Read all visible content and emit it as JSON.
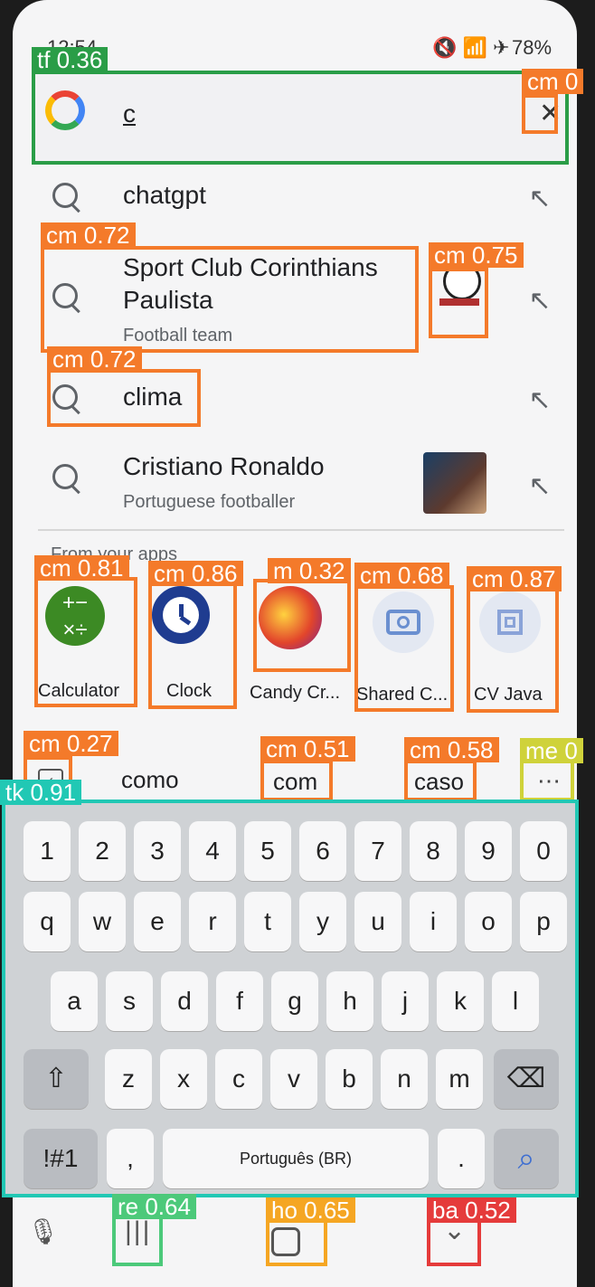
{
  "status": {
    "time": "12:54",
    "battery": "78%"
  },
  "search": {
    "query": "c",
    "clear_icon": "close-icon"
  },
  "suggestions": [
    {
      "title": "chatgpt",
      "subtitle": ""
    },
    {
      "title": "Sport Club Corinthians",
      "title2": "Paulista",
      "subtitle": "Football team"
    },
    {
      "title": "clima",
      "subtitle": ""
    },
    {
      "title": "Cristiano Ronaldo",
      "subtitle": "Portuguese footballer"
    }
  ],
  "apps_section": {
    "label": "From your apps"
  },
  "apps": [
    "Calculator",
    "Clock",
    "Candy Cr...",
    "Shared C...",
    "CV Java"
  ],
  "predictions": [
    "como",
    "com",
    "caso"
  ],
  "keyboard": {
    "row_numbers": [
      "1",
      "2",
      "3",
      "4",
      "5",
      "6",
      "7",
      "8",
      "9",
      "0"
    ],
    "row1": [
      "q",
      "w",
      "e",
      "r",
      "t",
      "y",
      "u",
      "i",
      "o",
      "p"
    ],
    "row2": [
      "a",
      "s",
      "d",
      "f",
      "g",
      "h",
      "j",
      "k",
      "l"
    ],
    "row3": [
      "z",
      "x",
      "c",
      "v",
      "b",
      "n",
      "m"
    ],
    "symbols": "!#1",
    "comma": ",",
    "space_label": "Português (BR)",
    "period": "."
  },
  "detections": {
    "tf": "tf 0.36",
    "cm_close": "cm 0",
    "cm_sport": "cm 0.72",
    "cm_logo": "cm 0.75",
    "cm_clima": "cm 0.72",
    "cm_calc": "cm 0.81",
    "cm_clock": "cm 0.86",
    "cm_candy": "m 0.32",
    "cm_shared": "cm 0.68",
    "cm_cv": "cm 0.87",
    "cm_back": "cm 0.27",
    "cm_com": "cm 0.51",
    "cm_caso": "cm 0.58",
    "me": "me 0",
    "tk": "tk 0.91",
    "re": "re 0.64",
    "ho": "ho 0.65",
    "ba": "ba 0.52"
  },
  "colors": {
    "orange": "#f47a2a",
    "green": "#2a9d47",
    "teal": "#21c8b4",
    "red": "#e53b3b",
    "yellow": "#cfd23a",
    "gold": "#f5a623",
    "lime": "#4cc97a"
  }
}
